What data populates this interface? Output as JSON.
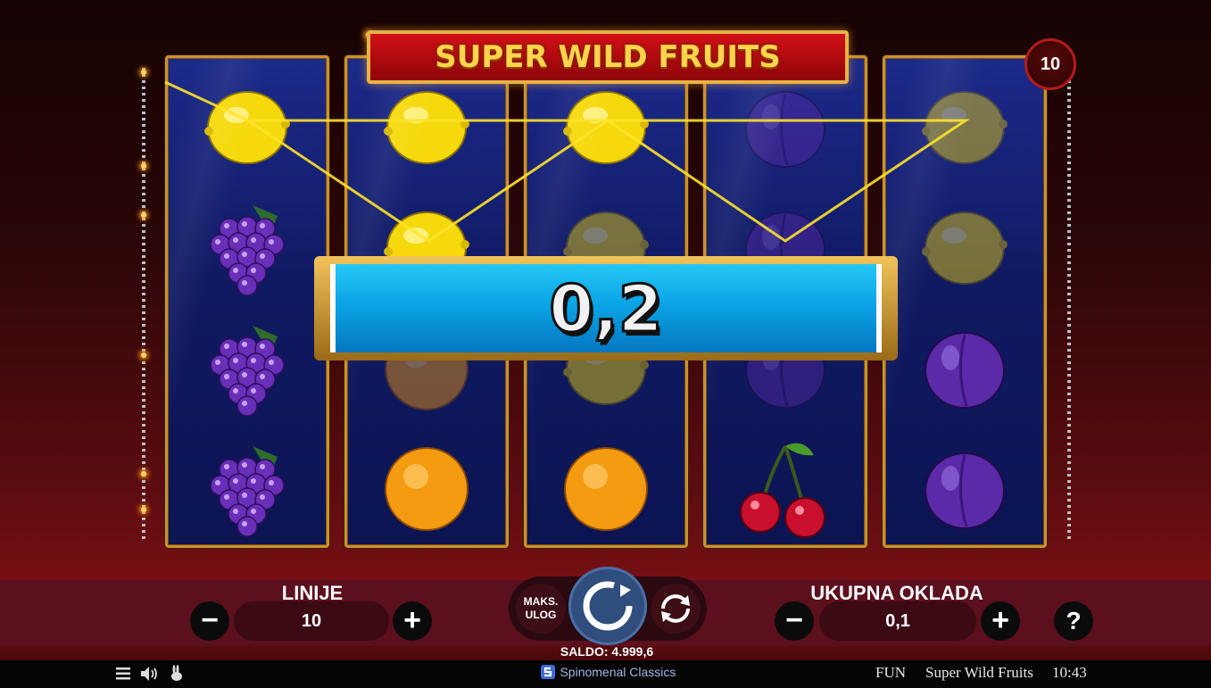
{
  "game": {
    "title": "SUPER WILD FRUITS",
    "lines_badge": "10",
    "win_amount": "0,2"
  },
  "reels": [
    [
      "lemon",
      "grapes",
      "grapes",
      "grapes"
    ],
    [
      "lemon",
      "lemon",
      "orange",
      "orange"
    ],
    [
      "lemon",
      "lemon",
      "lemon",
      "orange"
    ],
    [
      "plum",
      "plum",
      "plum",
      "cherries"
    ],
    [
      "lemon",
      "lemon",
      "plum",
      "plum"
    ]
  ],
  "controls": {
    "lines_label": "LINIJE",
    "lines_value": "10",
    "minus": "−",
    "plus": "+",
    "max_bet_label": "MAKS. ULOG",
    "total_bet_label": "UKUPNA OKLADA",
    "total_bet_value": "0,1",
    "help": "?",
    "balance": "SALDO: 4.999,6"
  },
  "footer": {
    "brand": "Spinomenal Classics",
    "mode": "FUN",
    "game_name": "Super Wild Fruits",
    "time": "10:43"
  },
  "colors": {
    "reel_bg": "#101a63",
    "reel_border": "#c9922d",
    "win_bar": "#0aa4e4",
    "payline": "#ffe22a",
    "control_bar": "#5c0f1c",
    "spin_button": "#2f4d7d"
  }
}
